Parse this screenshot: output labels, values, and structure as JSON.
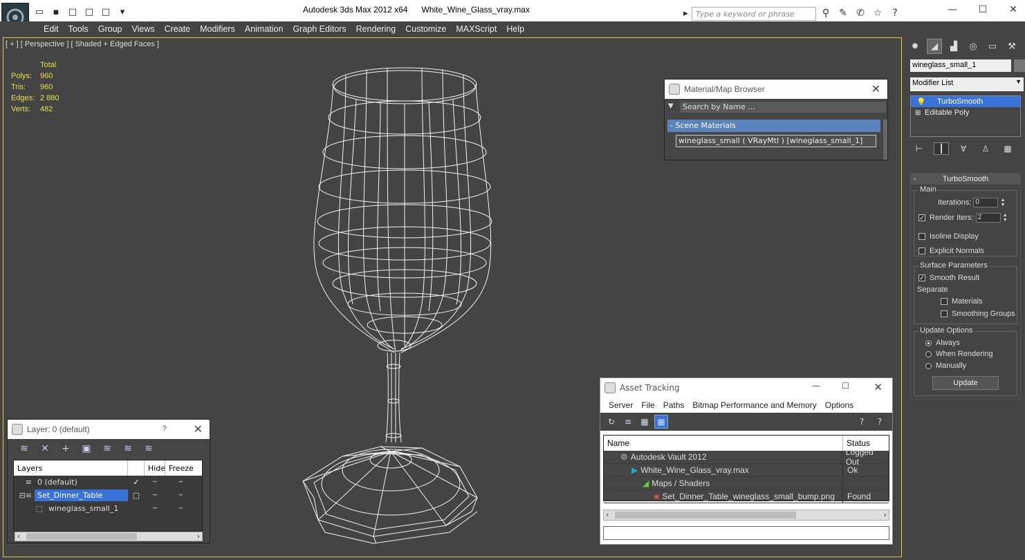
{
  "title": {
    "app": "Autodesk 3ds Max  2012 x64",
    "file": "White_Wine_Glass_vray.max"
  },
  "search": {
    "placeholder": "Type a keyword or phrase"
  },
  "menu": [
    "Edit",
    "Tools",
    "Group",
    "Views",
    "Create",
    "Modifiers",
    "Animation",
    "Graph Editors",
    "Rendering",
    "Customize",
    "MAXScript",
    "Help"
  ],
  "viewport": {
    "label": "[ + ] [ Perspective ] [ Shaded + Edged Faces ]",
    "stats_header": "Total",
    "stats": [
      {
        "k": "Polys:",
        "v": "960"
      },
      {
        "k": "Tris:",
        "v": "960"
      },
      {
        "k": "Edges:",
        "v": "2 880"
      },
      {
        "k": "Verts:",
        "v": "482"
      }
    ]
  },
  "material_browser": {
    "title": "Material/Map Browser",
    "search_placeholder": "Search by Name ...",
    "group": "- Scene Materials",
    "item": "wineglass_small  ( VRayMtl ) [wineglass_small_1]"
  },
  "layer_window": {
    "title": "Layer: 0 (default)",
    "help": "?",
    "columns": [
      "Layers",
      "Hide",
      "Freeze"
    ],
    "rows": [
      {
        "name": "0 (default)",
        "check": "✓",
        "selected": false
      },
      {
        "name": "Set_Dinner_Table",
        "check": "",
        "selected": true
      },
      {
        "name": "wineglass_small_1",
        "check": "",
        "selected": false
      }
    ]
  },
  "asset_tracking": {
    "title": "Asset Tracking",
    "menu": [
      "Server",
      "File",
      "Paths",
      "Bitmap Performance and Memory",
      "Options"
    ],
    "columns": [
      "Name",
      "Status"
    ],
    "rows": [
      {
        "name": "Autodesk Vault 2012",
        "status": "Logged Out",
        "indent": 24
      },
      {
        "name": "White_Wine_Glass_vray.max",
        "status": "Ok",
        "indent": 40
      },
      {
        "name": "Maps / Shaders",
        "status": "",
        "indent": 56
      },
      {
        "name": "Set_Dinner_Table_wineglass_small_bump.png",
        "status": "Found",
        "indent": 72
      }
    ]
  },
  "command_panel": {
    "object_name": "wineglass_small_1",
    "modifier_list": "Modifier List",
    "stack": [
      "TurboSmooth",
      "Editable Poly"
    ],
    "rollout_title": "TurboSmooth",
    "main_label": "Main",
    "iterations_label": "Iterations:",
    "iterations_value": "0",
    "render_iters_label": "Render Iters:",
    "render_iters_value": "2",
    "isoline": "Isoline Display",
    "explicit": "Explicit Normals",
    "surface_label": "Surface Parameters",
    "smooth_result": "Smooth Result",
    "separate": "Separate",
    "materials": "Materials",
    "smoothing_groups": "Smoothing Groups",
    "update_label": "Update Options",
    "always": "Always",
    "when_rendering": "When Rendering",
    "manually": "Manually",
    "update_btn": "Update"
  },
  "colors": {
    "accent": "#3a72d8",
    "stats": "#e8e04a",
    "viewport_border": "#e8c84a"
  }
}
